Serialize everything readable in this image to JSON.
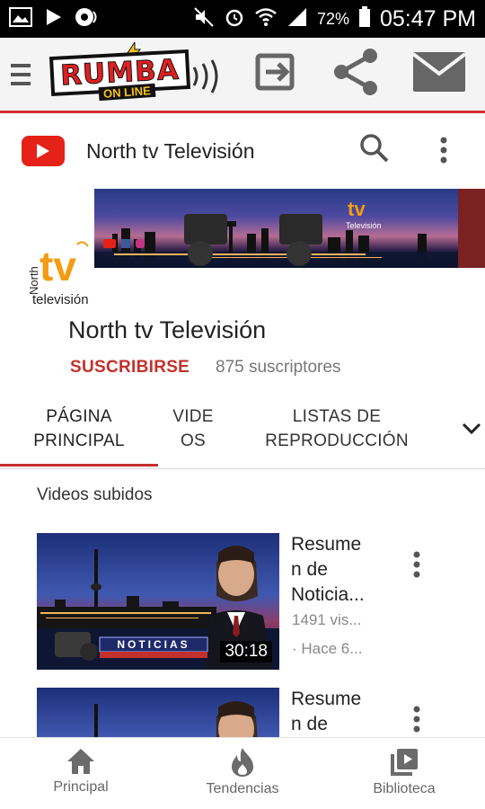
{
  "status_bar": {
    "battery": "72%",
    "time": "05:47 PM"
  },
  "app_toolbar": {
    "logo_word": "RUMBA",
    "logo_tagline": "ON LINE"
  },
  "youtube_header": {
    "title": "North tv Televisión"
  },
  "channel": {
    "avatar_text_tv": "tv",
    "avatar_text_north": "North",
    "avatar_text_television": "televisión",
    "name": "North tv Televisión",
    "subscribe_label": "SUSCRIBIRSE",
    "subscriber_count": "875 suscriptores"
  },
  "tabs": [
    {
      "line1": "PÁGINA",
      "line2": "PRINCIPAL",
      "active": true
    },
    {
      "line1": "VIDE",
      "line2": "OS",
      "active": false
    },
    {
      "line1": "LISTAS DE",
      "line2": "REPRODUCCIÓN",
      "active": false
    }
  ],
  "section": {
    "title": "Videos subidos"
  },
  "videos": [
    {
      "title_lines": [
        "Resume",
        "n de",
        "Noticia..."
      ],
      "views": "1491 vis...",
      "age": "· Hace 6...",
      "duration": "30:18",
      "thumb_caption": "NOTICIAS"
    },
    {
      "title_lines": [
        "Resume",
        "n de"
      ]
    }
  ],
  "bottom_nav": [
    {
      "label": "Principal",
      "icon": "home-icon"
    },
    {
      "label": "Tendencias",
      "icon": "flame-icon"
    },
    {
      "label": "Biblioteca",
      "icon": "library-icon"
    }
  ],
  "colors": {
    "youtube_red": "#e62117",
    "subscribe_red": "#c4302b",
    "toolbar_bg": "#f4f4f4",
    "status_bar_bg": "#000000"
  }
}
